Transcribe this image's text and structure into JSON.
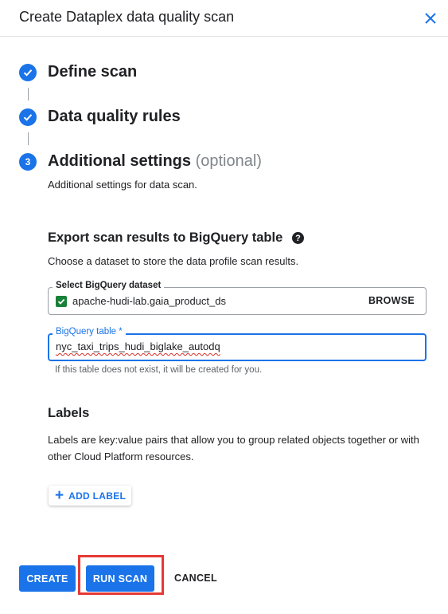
{
  "dialog": {
    "title": "Create Dataplex data quality scan"
  },
  "steps": [
    {
      "label": "Define scan",
      "state": "completed",
      "icon": "check-icon"
    },
    {
      "label": "Data quality rules",
      "state": "completed",
      "icon": "check-icon"
    },
    {
      "number": "3",
      "label": "Additional settings",
      "optional": "(optional)",
      "description": "Additional settings for data scan.",
      "state": "active"
    }
  ],
  "export": {
    "title": "Export scan results to BigQuery table",
    "help_icon": "?",
    "description": "Choose a dataset to store the data profile scan results.",
    "dataset_label": "Select BigQuery dataset",
    "dataset_value": "apache-hudi-lab.gaia_product_ds",
    "browse_label": "BROWSE",
    "table_label": "BigQuery table *",
    "table_value": "nyc_taxi_trips_hudi_biglake_autodq",
    "table_hint": "If this table does not exist, it will be created for you."
  },
  "labels": {
    "title": "Labels",
    "description_line1": "Labels are key:value pairs that allow you to group related objects together or with",
    "description_line2": "other Cloud Platform resources.",
    "add_label": "ADD LABEL"
  },
  "actions": {
    "create": "CREATE",
    "run_scan": "RUN SCAN",
    "cancel": "CANCEL"
  },
  "colors": {
    "accent": "#1a73e8",
    "checkbox": "#188038",
    "highlight": "#e53935"
  }
}
